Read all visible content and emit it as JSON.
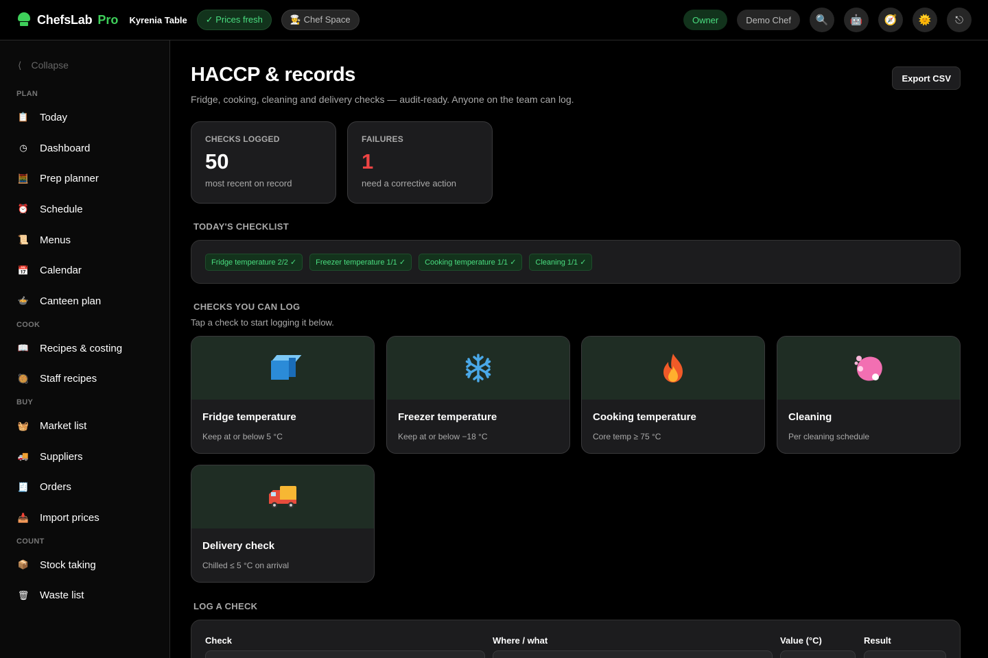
{
  "topbar": {
    "brand": "ChefsLab",
    "brand_suffix": "Pro",
    "venue": "Kyrenia Table",
    "prices_status": "✓ Prices fresh",
    "space_label": "🧑‍🍳 Chef Space",
    "role": "Owner",
    "user": "Demo Chef",
    "icons": [
      "search-icon",
      "robot-icon",
      "compass-icon",
      "sun-icon",
      "logout-icon"
    ]
  },
  "sidebar": {
    "collapse_label": "Collapse",
    "sections": [
      {
        "label": "PLAN",
        "items": [
          {
            "label": "Today",
            "icon": "📋"
          },
          {
            "label": "Dashboard",
            "icon": "◷"
          },
          {
            "label": "Prep planner",
            "icon": "🧮"
          },
          {
            "label": "Schedule",
            "icon": "⏰"
          },
          {
            "label": "Menus",
            "icon": "📜"
          },
          {
            "label": "Calendar",
            "icon": "📅"
          },
          {
            "label": "Canteen plan",
            "icon": "🍲"
          }
        ]
      },
      {
        "label": "COOK",
        "items": [
          {
            "label": "Recipes & costing",
            "icon": "📖"
          },
          {
            "label": "Staff recipes",
            "icon": "🥘"
          }
        ]
      },
      {
        "label": "BUY",
        "items": [
          {
            "label": "Market list",
            "icon": "🧺"
          },
          {
            "label": "Suppliers",
            "icon": "🚚"
          },
          {
            "label": "Orders",
            "icon": "🧾"
          },
          {
            "label": "Import prices",
            "icon": "📥"
          }
        ]
      },
      {
        "label": "COUNT",
        "items": [
          {
            "label": "Stock taking",
            "icon": "📦"
          },
          {
            "label": "Waste list",
            "icon": "🗑"
          }
        ]
      }
    ]
  },
  "page": {
    "title": "HACCP & records",
    "subtitle": "Fridge, cooking, cleaning and delivery checks — audit-ready. Anyone on the team can log.",
    "export_label": "Export CSV"
  },
  "stats": [
    {
      "label": "CHECKS LOGGED",
      "value": "50",
      "note": "most recent on record",
      "color": "#ffffff"
    },
    {
      "label": "FAILURES",
      "value": "1",
      "note": "need a corrective action",
      "color": "#ef4444"
    }
  ],
  "checklist": {
    "title": "TODAY'S CHECKLIST",
    "chips": [
      "Fridge temperature 2/2 ✓",
      "Freezer temperature 1/1 ✓",
      "Cooking temperature 1/1 ✓",
      "Cleaning 1/1 ✓"
    ]
  },
  "checks": {
    "title": "CHECKS YOU CAN LOG",
    "hint": "Tap a check to start logging it below.",
    "cards": [
      {
        "title": "Fridge temperature",
        "sub": "Keep at or below 5 °C",
        "icon": "ice-cube-icon"
      },
      {
        "title": "Freezer temperature",
        "sub": "Keep at or below −18 °C",
        "icon": "snowflake-icon"
      },
      {
        "title": "Cooking temperature",
        "sub": "Core temp ≥ 75 °C",
        "icon": "fire-icon"
      },
      {
        "title": "Cleaning",
        "sub": "Per cleaning schedule",
        "icon": "sponge-icon"
      },
      {
        "title": "Delivery check",
        "sub": "Chilled ≤ 5 °C on arrival",
        "icon": "delivery-truck-icon"
      }
    ]
  },
  "log": {
    "title": "LOG A CHECK",
    "fields": [
      "Check",
      "Where / what",
      "Value (°C)",
      "Result"
    ]
  }
}
